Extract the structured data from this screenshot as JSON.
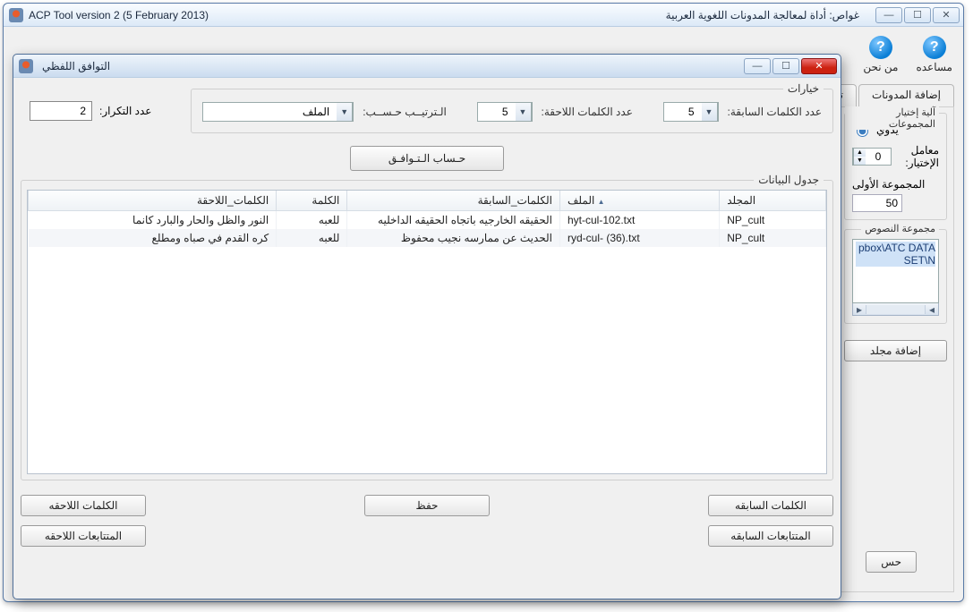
{
  "main_window": {
    "title_left": "ACP Tool version 2 (5 February 2013)",
    "title_right": "غواص: أداة لمعالجة المدونات اللغوية العربية",
    "top_icons": {
      "help": "مساعده",
      "about": "من نحن",
      "glyph": "?"
    },
    "tabs": {
      "add_corpora": "إضافة المدونات",
      "token_cut": "تنقي"
    },
    "group_select": {
      "legend": "آلية إختيار المجموعات",
      "radio_manual": "يدوي",
      "coeff_label": "معامل الإختيار:",
      "coeff_value": "0",
      "group1_label": "المجموعة الأولى",
      "group1_value": "50"
    },
    "text_group": {
      "legend": "مجموعة النصوص",
      "item": "pbox\\ATC DATA SET\\N"
    },
    "add_folder_btn": "إضافة مجلد",
    "compute_btn": "حس"
  },
  "dialog": {
    "title": "التوافق اللفظي",
    "options_legend": "خيارات",
    "prev_words_label": "عدد الكلمات السابقة:",
    "prev_words_value": "5",
    "next_words_label": "عدد الكلمات اللاحقة:",
    "next_words_value": "5",
    "sort_label": "الـترتيــب حـســب:",
    "sort_value": "الملف",
    "freq_label": "عدد التكرار:",
    "freq_value": "2",
    "compute_btn": "حـساب الـتـوافـق",
    "data_legend": "جدول البيانات",
    "columns": {
      "folder": "المجلد",
      "file": "الملف",
      "prev": "الكلمات_السابقة",
      "word": "الكلمة",
      "next": "الكلمات_اللاحقة"
    },
    "rows": [
      {
        "folder": "NP_cult",
        "file": "hyt-cul-102.txt",
        "prev": "الحقيقه الخارجيه باتجاه الحقيقه الداخليه",
        "word": "للعبه",
        "next": "النور والظل والحار والبارد كانما"
      },
      {
        "folder": "NP_cult",
        "file": "ryd-cul- (36).txt",
        "prev": "الحديث عن ممارسه نجيب محفوظ",
        "word": "للعبه",
        "next": "كره القدم في صباه ومطلع"
      }
    ],
    "buttons": {
      "prev_words": "الكلمات السابقه",
      "next_words": "الكلمات اللاحقه",
      "prev_colloc": "المتتابعات السابقه",
      "next_colloc": "المتتابعات اللاحقه",
      "save": "حفظ"
    }
  }
}
